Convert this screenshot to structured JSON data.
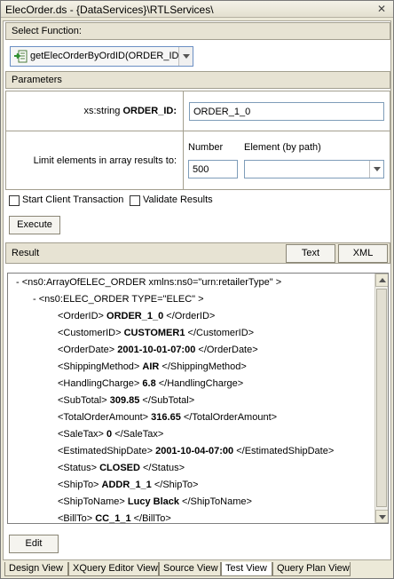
{
  "window": {
    "title": "ElecOrder.ds - {DataServices}\\RTLServices\\"
  },
  "select_function": {
    "header": "Select Function:",
    "selected": "getElecOrderByOrdID(ORDER_ID)"
  },
  "parameters": {
    "header": "Parameters",
    "order_id_type": "xs:string",
    "order_id_name": "ORDER_ID:",
    "order_id_value": "ORDER_1_0",
    "limit_label": "Limit elements in array results to:",
    "number_label": "Number",
    "number_value": "500",
    "element_label": "Element (by path)",
    "element_value": ""
  },
  "options": {
    "start_client_transaction": "Start Client Transaction",
    "start_client_transaction_checked": false,
    "validate_results": "Validate Results",
    "validate_results_checked": false
  },
  "execute_button": "Execute",
  "result": {
    "header": "Result",
    "text_button": "Text",
    "xml_button": "XML",
    "lines": [
      {
        "prefix": "-",
        "pre": "<ns0:ArrayOfELEC_ORDER xmlns:ns0=\"urn:retailerType\" >",
        "val": "",
        "post": ""
      },
      {
        "prefix": "-",
        "pre": "<ns0:ELEC_ORDER TYPE=\"ELEC\" >",
        "val": "",
        "post": ""
      },
      {
        "prefix": "",
        "pre": "<OrderID>",
        "val": "ORDER_1_0",
        "post": "</OrderID>"
      },
      {
        "prefix": "",
        "pre": "<CustomerID>",
        "val": "CUSTOMER1",
        "post": "</CustomerID>"
      },
      {
        "prefix": "",
        "pre": "<OrderDate>",
        "val": "2001-10-01-07:00",
        "post": "</OrderDate>"
      },
      {
        "prefix": "",
        "pre": "<ShippingMethod>",
        "val": "AIR",
        "post": "</ShippingMethod>"
      },
      {
        "prefix": "",
        "pre": "<HandlingCharge>",
        "val": "6.8",
        "post": "</HandlingCharge>"
      },
      {
        "prefix": "",
        "pre": "<SubTotal>",
        "val": "309.85",
        "post": "</SubTotal>"
      },
      {
        "prefix": "",
        "pre": "<TotalOrderAmount>",
        "val": "316.65",
        "post": "</TotalOrderAmount>"
      },
      {
        "prefix": "",
        "pre": "<SaleTax>",
        "val": "0",
        "post": "</SaleTax>"
      },
      {
        "prefix": "",
        "pre": "<EstimatedShipDate>",
        "val": "2001-10-04-07:00",
        "post": "</EstimatedShipDate>"
      },
      {
        "prefix": "",
        "pre": "<Status>",
        "val": "CLOSED",
        "post": "</Status>"
      },
      {
        "prefix": "",
        "pre": "<ShipTo>",
        "val": "ADDR_1_1",
        "post": "</ShipTo>"
      },
      {
        "prefix": "",
        "pre": "<ShipToName>",
        "val": "Lucy Black",
        "post": "</ShipToName>"
      },
      {
        "prefix": "",
        "pre": "<BillTo>",
        "val": "CC_1_1",
        "post": "</BillTo>"
      }
    ]
  },
  "edit_button": "Edit",
  "bottom_tabs": [
    {
      "label": "Design View",
      "active": false
    },
    {
      "label": "XQuery Editor View",
      "active": false
    },
    {
      "label": "Source View",
      "active": false
    },
    {
      "label": "Test View",
      "active": true
    },
    {
      "label": "Query Plan View",
      "active": false
    }
  ],
  "colors": {
    "accent": "#6b8fc4",
    "header_bg": "#e7e3d3",
    "window_bg": "#ece9d8"
  }
}
